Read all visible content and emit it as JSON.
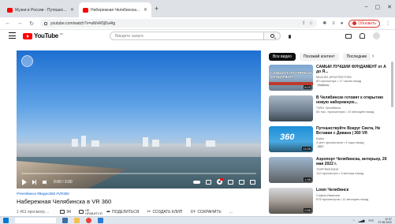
{
  "browser": {
    "tabs": [
      {
        "title": "Музеи в России - Путешестви"
      },
      {
        "title": "Набережная Челябинска в VR"
      }
    ],
    "url": "youtube.com/watch?v=aWvR0jDu4tg",
    "update_label": "Обновить"
  },
  "youtube": {
    "logo_text": "YouTube",
    "logo_country": "RU",
    "search_placeholder": "Введите запрос"
  },
  "video": {
    "time": "0:00 / 3:00",
    "progress": 0,
    "tags": "#Челябинск #Видео360 #VR360",
    "title": "Набережная Челябинска в VR 360",
    "views": "1 461 просмотр ...",
    "like_count": "94",
    "dislike_label": "НЕ НРАВИТСЯ",
    "share_label": "ПОДЕЛИТЬСЯ",
    "clip_label": "СОЗДАТЬ КЛИП",
    "save_label": "СОХРАНИТЬ",
    "more_label": "..."
  },
  "chips": [
    "Все видео",
    "Похожий контент",
    "Последние"
  ],
  "recommendations": [
    {
      "title": "САМЫЙ ЛУЧШИЙ ФУНДАМЕНТ от А до Я...",
      "channel": "МЫСЛИ АРХИТЕКТОРА",
      "meta": "83 просмотра • 17 часов назад",
      "badge": "Новинка",
      "thumb_text": "САМЫЙ ПОПУЛЯРНЫЙ ФУНДАМЕНТ",
      "duration": "8:23"
    },
    {
      "title": "В Челябинске готовят к открытию новую набережную...",
      "channel": "74RU Челябинск",
      "meta": "83 тыс. просмотров • 10 месяцев назад",
      "badge": "",
      "thumb_text": "",
      "duration": ""
    },
    {
      "title": "Путешествуйте Вокруг Света, Не Вставая с Дивана | 360 VR",
      "channel": "Kaiko",
      "meta": "4 млн просмотров • 4 года назад",
      "badge": "360°",
      "thumb_text": "360",
      "duration": "11:05"
    },
    {
      "title": "Аэропорт Челябинска, интерьер, 26 мая 2022 г.",
      "channel": "TOPFREERIDE",
      "meta": "143 просмотра • 3 месяца назад",
      "badge": "",
      "thumb_text": "",
      "duration": "1:46"
    },
    {
      "title": "Lown Челябинск",
      "channel": "София Иванова",
      "meta": "676 просмотров • 11 месяцев назад",
      "badge": "",
      "thumb_text": "",
      "duration": "0:56"
    }
  ],
  "taskbar": {
    "clock_time": "12:37",
    "clock_date": "27.08.2022",
    "lang": "РУС"
  }
}
